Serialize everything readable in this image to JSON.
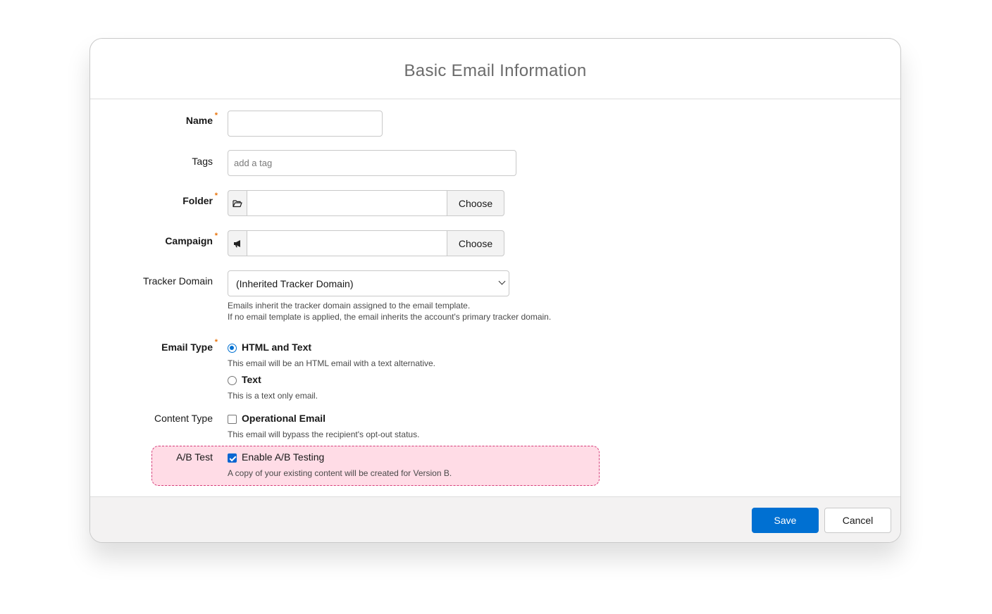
{
  "dialog": {
    "title": "Basic Email Information"
  },
  "form": {
    "name": {
      "label": "Name",
      "required_mark": "*",
      "value": ""
    },
    "tags": {
      "label": "Tags",
      "placeholder": "add a tag"
    },
    "folder": {
      "label": "Folder",
      "required_mark": "*",
      "icon": "folder-open-icon",
      "value": "",
      "button": "Choose"
    },
    "campaign": {
      "label": "Campaign",
      "required_mark": "*",
      "icon": "megaphone-icon",
      "value": "",
      "button": "Choose"
    },
    "tracker_domain": {
      "label": "Tracker Domain",
      "selected": "(Inherited Tracker Domain)",
      "help_line1": "Emails inherit the tracker domain assigned to the email template.",
      "help_line2": "If no email template is applied, the email inherits the account's primary tracker domain."
    },
    "email_type": {
      "label": "Email Type",
      "required_mark": "*",
      "options": [
        {
          "label": "HTML and Text",
          "help": "This email will be an HTML email with a text alternative.",
          "checked": true
        },
        {
          "label": "Text",
          "help": "This is a text only email.",
          "checked": false
        }
      ]
    },
    "content_type": {
      "label": "Content Type",
      "option": "Operational Email",
      "help": "This email will bypass the recipient's opt-out status.",
      "checked": false
    },
    "ab_test": {
      "label": "A/B Test",
      "option": "Enable A/B Testing",
      "help": "A copy of your existing content will be created for Version B.",
      "checked": true,
      "highlight_color": "#ffdce6"
    }
  },
  "footer": {
    "save": "Save",
    "cancel": "Cancel",
    "accent": "#0070d2"
  }
}
